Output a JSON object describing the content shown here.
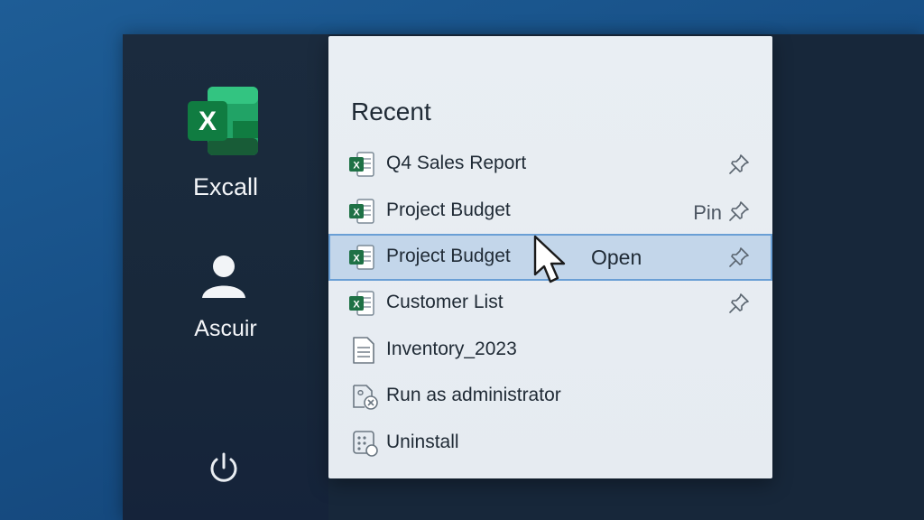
{
  "app": {
    "name": "Excall"
  },
  "user": {
    "name": "Ascuir"
  },
  "recent": {
    "title": "Recent",
    "items": [
      {
        "label": "Q4 Sales Report",
        "icon": "excel-file-icon",
        "pinned_hint": ""
      },
      {
        "label": "Project Budget",
        "icon": "excel-file-icon",
        "pinned_hint": "Pin"
      },
      {
        "label": "Project Budget",
        "icon": "excel-file-icon",
        "pinned_hint": "Open",
        "selected": true
      },
      {
        "label": "Customer List",
        "icon": "excel-file-icon",
        "pinned_hint": ""
      }
    ]
  },
  "actions": [
    {
      "label": "Inventory_2023",
      "icon": "document-icon"
    },
    {
      "label": "Run as administrator",
      "icon": "admin-shield-icon"
    },
    {
      "label": "Uninstall",
      "icon": "uninstall-icon"
    }
  ],
  "colors": {
    "excel_green": "#1e7145",
    "selection_bg": "#c3d6ea",
    "selection_border": "#6a9fd5",
    "rail_bg": "#18283a"
  }
}
